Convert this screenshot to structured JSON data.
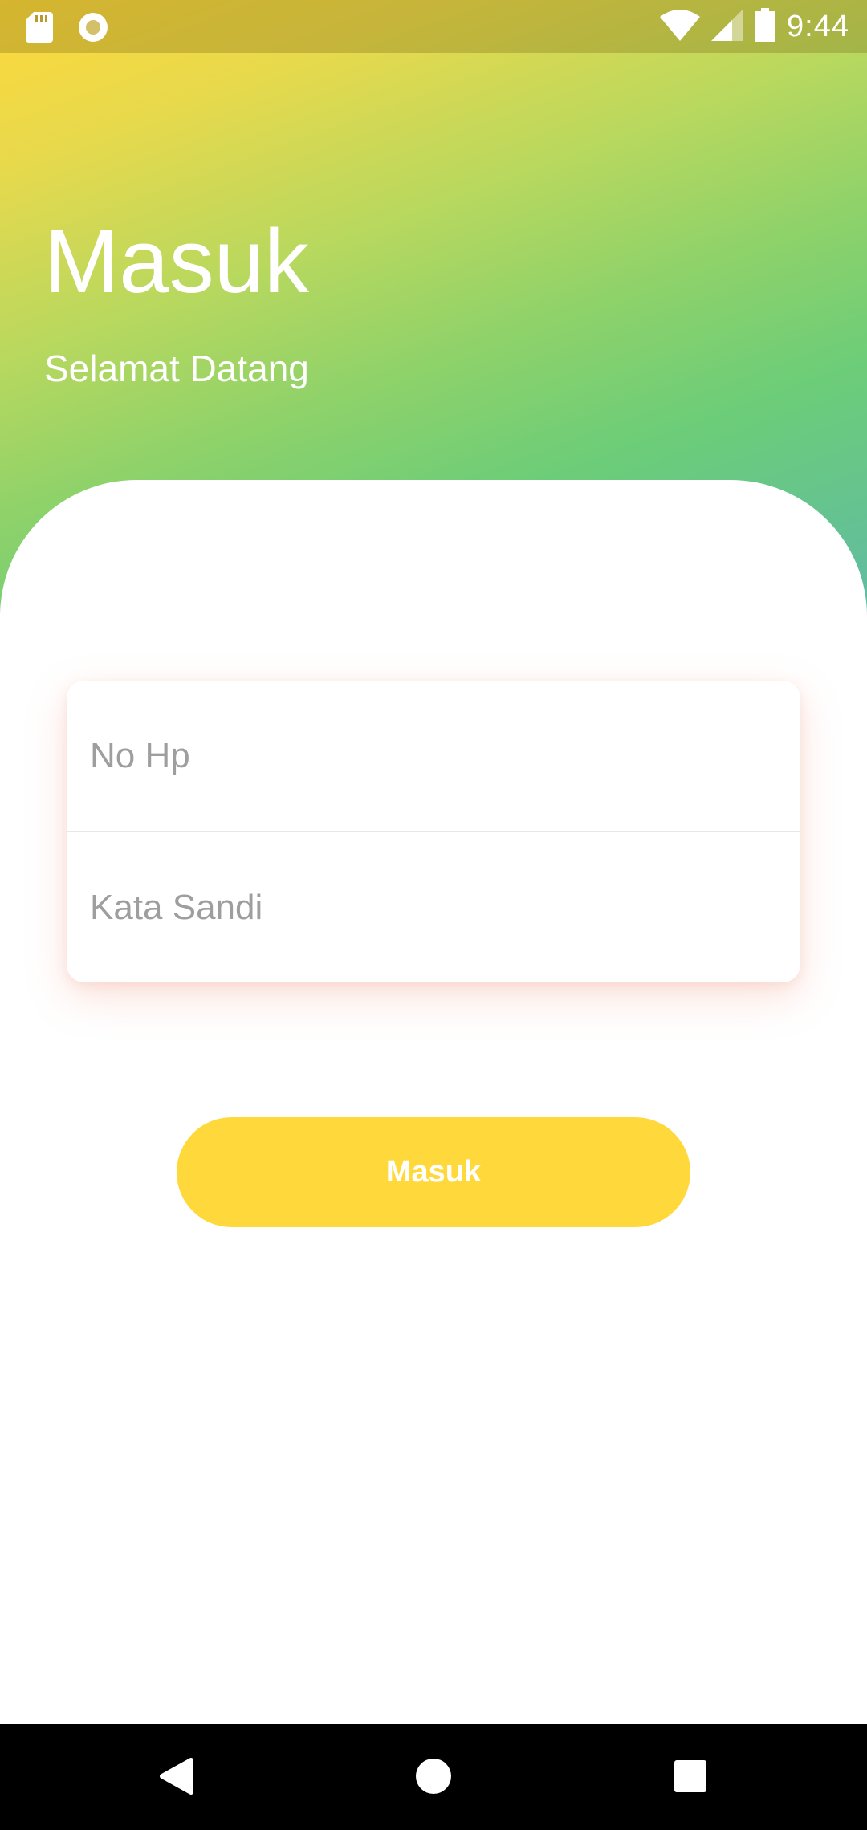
{
  "status_bar": {
    "time": "9:44",
    "icons": [
      "sd-card-icon",
      "circle-notification-icon",
      "wifi-icon",
      "signal-icon",
      "battery-icon"
    ]
  },
  "header": {
    "title": "Masuk",
    "subtitle": "Selamat Datang",
    "gradient_colors": [
      "#ffd93b",
      "#8fd26a",
      "#5fbaa5"
    ]
  },
  "form": {
    "phone_placeholder": "No Hp",
    "password_placeholder": "Kata Sandi"
  },
  "login_button": {
    "label": "Masuk",
    "color": "#ffd93b"
  },
  "nav_bar": {
    "icons": [
      "back-icon",
      "home-icon",
      "recents-icon"
    ]
  }
}
